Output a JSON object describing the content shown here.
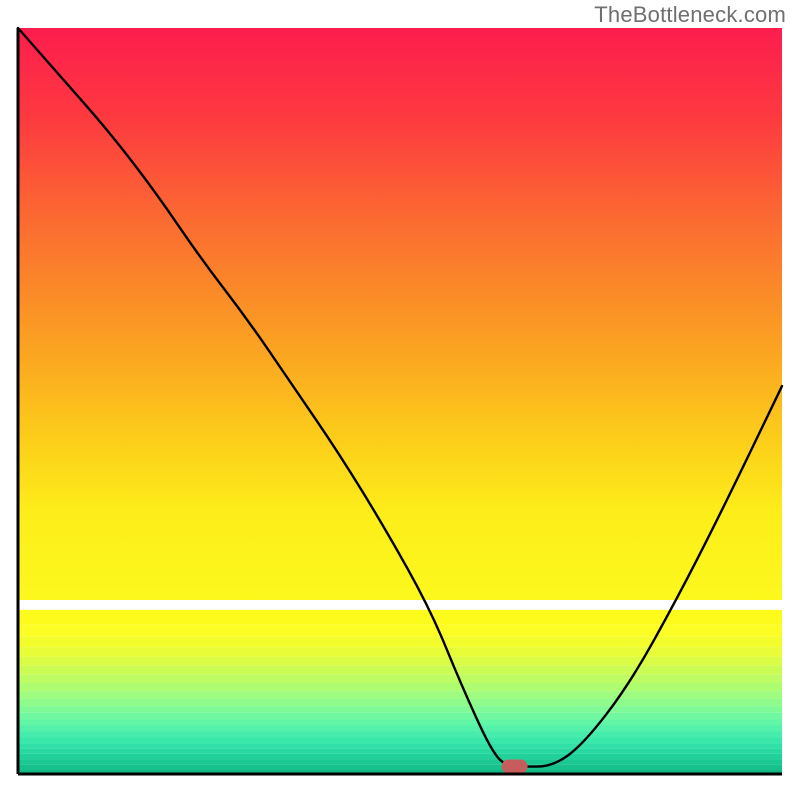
{
  "watermark": "TheBottleneck.com",
  "chart_data": {
    "type": "line",
    "title": "",
    "xlabel": "",
    "ylabel": "",
    "xlim": [
      0,
      100
    ],
    "ylim": [
      0,
      100
    ],
    "x": [
      0,
      6,
      12,
      18,
      24,
      30,
      36,
      42,
      48,
      54,
      58,
      62,
      64,
      66,
      70,
      74,
      80,
      86,
      92,
      100
    ],
    "values": [
      100,
      93,
      86,
      78,
      69,
      61,
      52,
      43,
      33,
      22,
      12,
      3,
      1,
      1,
      1,
      4,
      12,
      23,
      35,
      52
    ],
    "marker": {
      "x": 65,
      "y": 1,
      "color": "#c75c5c"
    },
    "background_gradient": {
      "stops": [
        {
          "pos": 0.0,
          "color": "#fd1d4e"
        },
        {
          "pos": 0.2,
          "color": "#fc4a38"
        },
        {
          "pos": 0.4,
          "color": "#fb832a"
        },
        {
          "pos": 0.6,
          "color": "#fcc11d"
        },
        {
          "pos": 0.76,
          "color": "#fdee1a"
        },
        {
          "pos": 0.8,
          "color": "#fdfb1c"
        },
        {
          "pos": 0.83,
          "color": "#f2fb26"
        },
        {
          "pos": 0.86,
          "color": "#d8fb40"
        },
        {
          "pos": 0.89,
          "color": "#b6fb5e"
        },
        {
          "pos": 0.92,
          "color": "#8cfb7e"
        },
        {
          "pos": 0.95,
          "color": "#5df79d"
        },
        {
          "pos": 0.975,
          "color": "#2fe9a1"
        },
        {
          "pos": 1.0,
          "color": "#17d28e"
        }
      ]
    },
    "bands": [
      {
        "y": 0.78,
        "h": 0.02,
        "color": "#fcfb1c"
      },
      {
        "y": 0.8,
        "h": 0.016,
        "color": "#fbfd24"
      },
      {
        "y": 0.816,
        "h": 0.014,
        "color": "#f3fd2c"
      },
      {
        "y": 0.83,
        "h": 0.013,
        "color": "#e8fd37"
      },
      {
        "y": 0.843,
        "h": 0.012,
        "color": "#dafc45"
      },
      {
        "y": 0.855,
        "h": 0.012,
        "color": "#cbfc54"
      },
      {
        "y": 0.867,
        "h": 0.011,
        "color": "#bdfc62"
      },
      {
        "y": 0.878,
        "h": 0.011,
        "color": "#aefc70"
      },
      {
        "y": 0.889,
        "h": 0.01,
        "color": "#9efc7e"
      },
      {
        "y": 0.899,
        "h": 0.01,
        "color": "#8ffb8b"
      },
      {
        "y": 0.909,
        "h": 0.009,
        "color": "#7ffa96"
      },
      {
        "y": 0.918,
        "h": 0.009,
        "color": "#70f8a0"
      },
      {
        "y": 0.927,
        "h": 0.008,
        "color": "#61f5a6"
      },
      {
        "y": 0.935,
        "h": 0.008,
        "color": "#53f1aa"
      },
      {
        "y": 0.943,
        "h": 0.008,
        "color": "#46ecac"
      },
      {
        "y": 0.951,
        "h": 0.008,
        "color": "#3ae7aa"
      },
      {
        "y": 0.959,
        "h": 0.007,
        "color": "#30e0a6"
      },
      {
        "y": 0.966,
        "h": 0.007,
        "color": "#27d9a0"
      },
      {
        "y": 0.973,
        "h": 0.007,
        "color": "#20d199"
      },
      {
        "y": 0.98,
        "h": 0.007,
        "color": "#1ac992"
      },
      {
        "y": 0.987,
        "h": 0.007,
        "color": "#16c18b"
      },
      {
        "y": 0.994,
        "h": 0.006,
        "color": "#12b984"
      }
    ]
  }
}
